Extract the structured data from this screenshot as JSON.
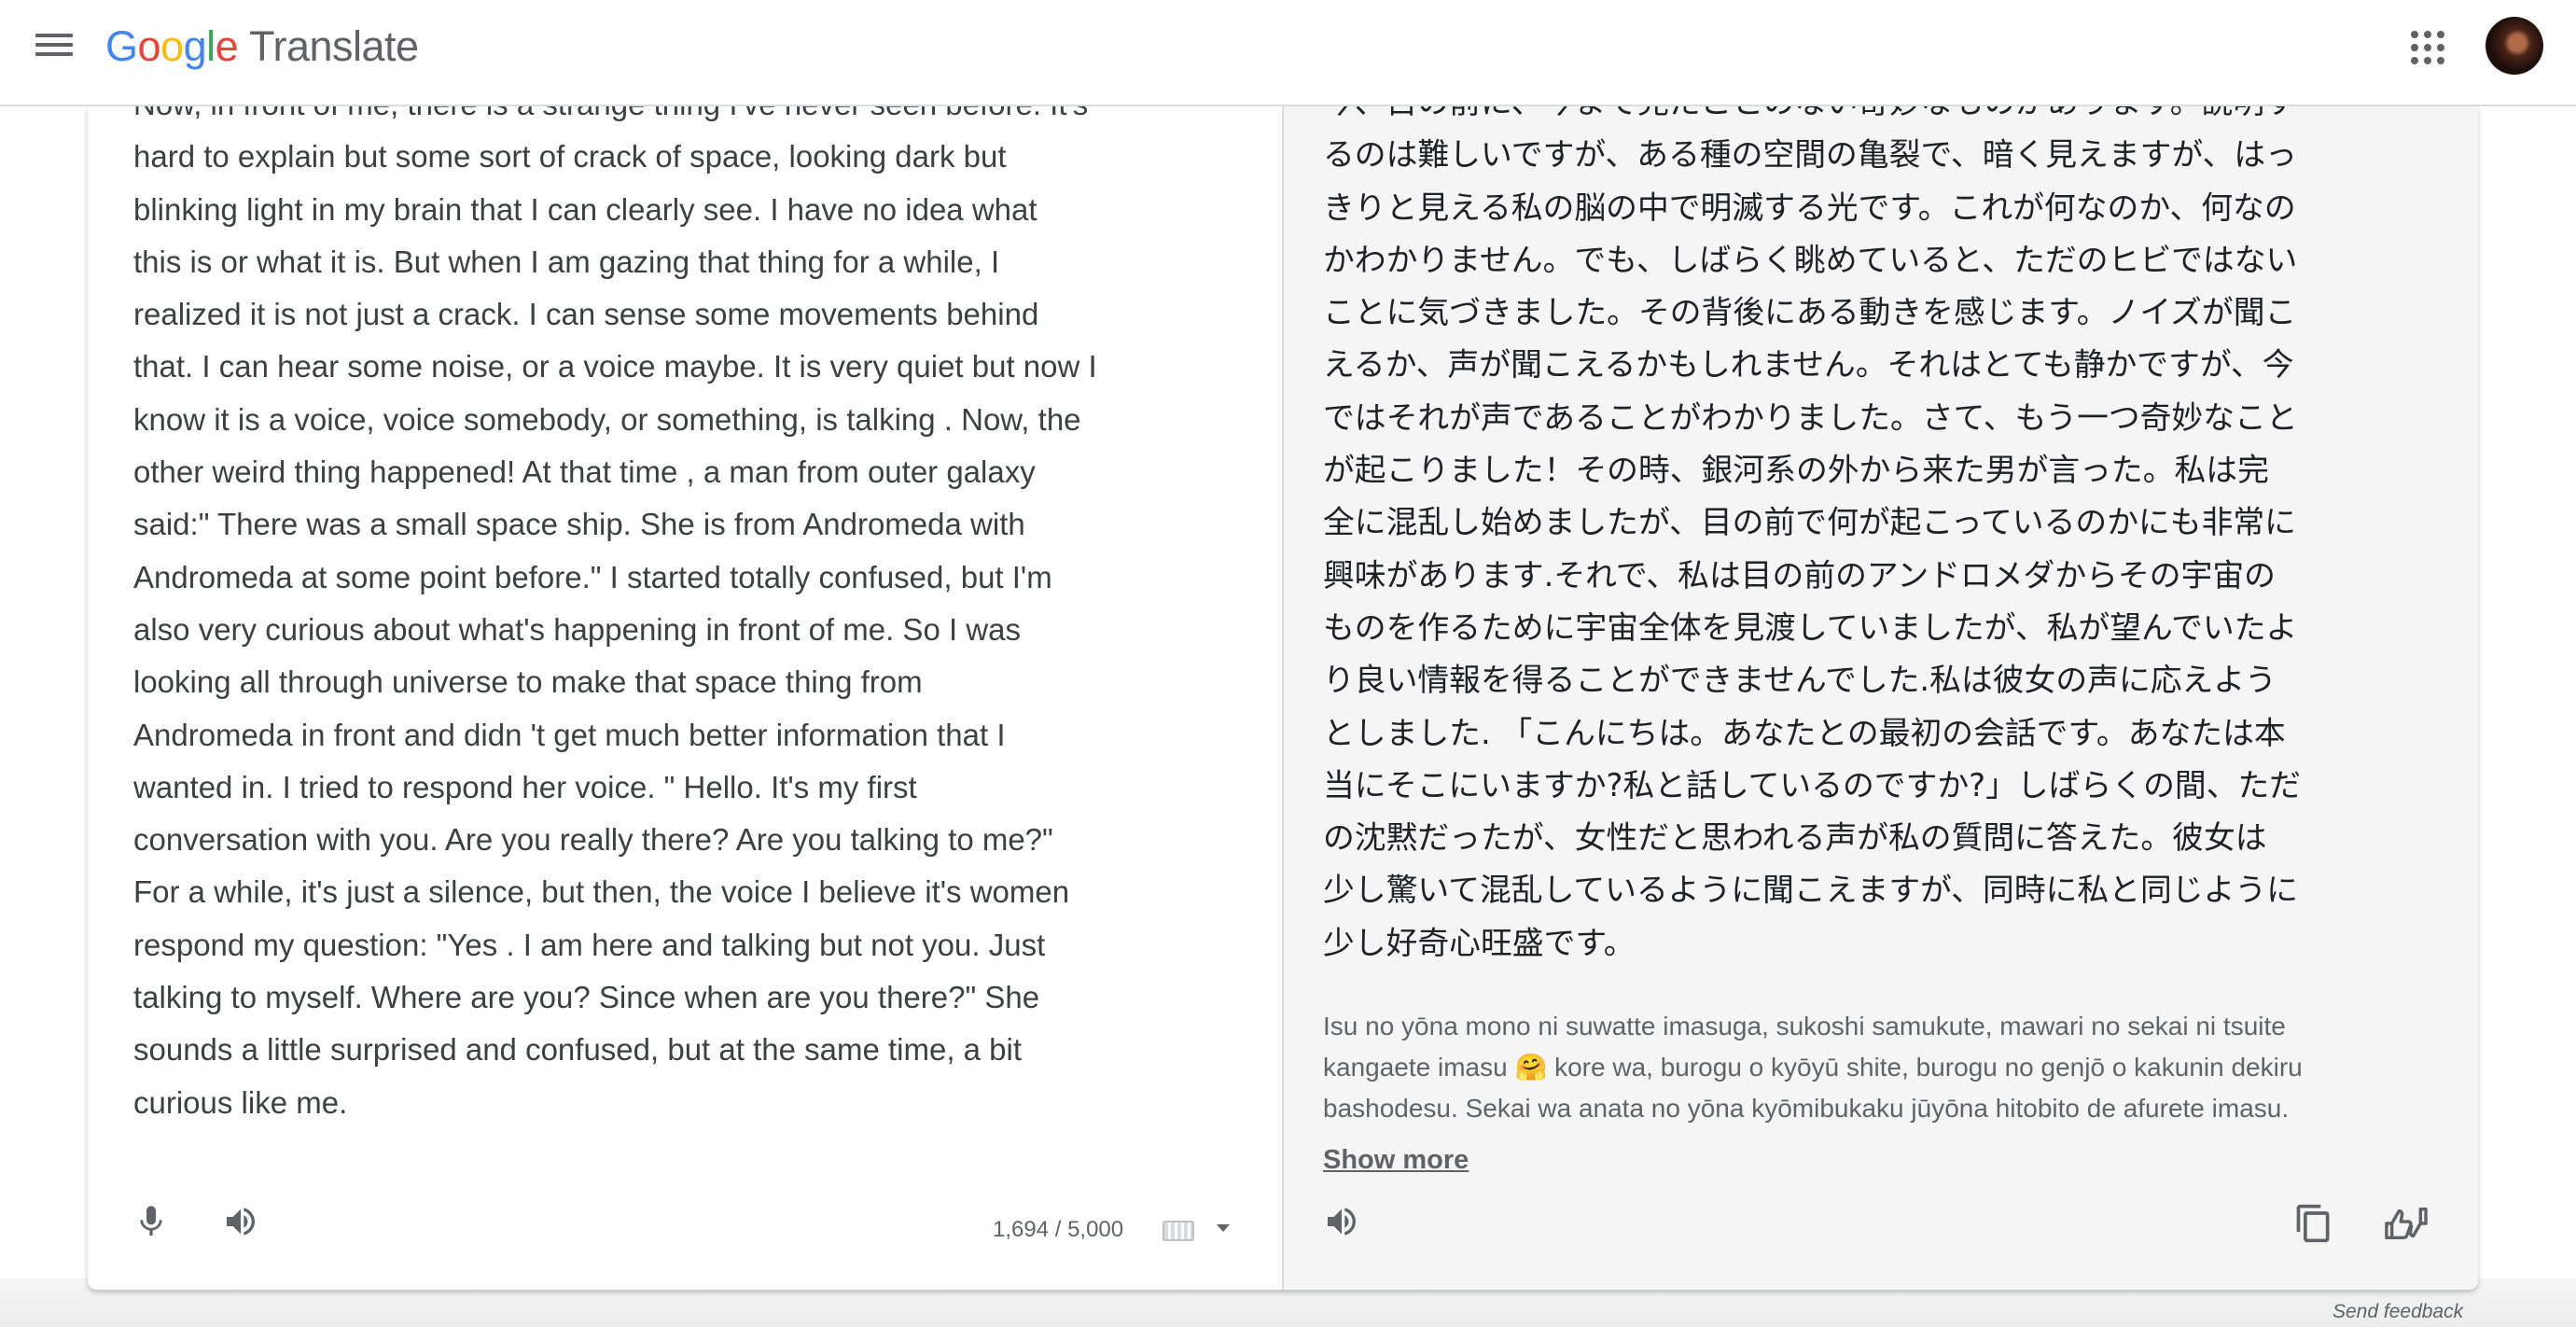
{
  "header": {
    "logo_letters": [
      "G",
      "o",
      "o",
      "g",
      "l",
      "e"
    ],
    "product": "Translate"
  },
  "source": {
    "text": "Now, in front of me, there is a strange thing I've never seen before. It's\nhard to explain but some sort of crack of space, looking dark but\nblinking light in my brain that I can clearly see. I have no idea what\nthis is or what it is. But when I am gazing that thing for a while, I\nrealized it is not just a crack. I can sense some movements behind\nthat. I can hear some noise, or a voice maybe. It is very quiet but now I\nknow it is a voice, voice somebody, or something, is talking . Now, the\nother weird thing happened! At that time , a man from outer galaxy\nsaid:\" There was a small space ship. She is from Andromeda with\nAndromeda at some point before.\" I started totally confused, but I'm\nalso very curious about what's happening in front of me. So I was\nlooking all through universe to make that space thing from\nAndromeda in front and didn 't get much better information that I\nwanted in. I tried to respond her voice. \" Hello. It's my first\nconversation with you. Are you really there? Are you talking to me?\"\nFor a while, it's just a silence, but then, the voice I believe it's women\nrespond my question: \"Yes . I am here and talking but not you. Just\ntalking to myself. Where are you? Since when are you there?\" She\nsounds a little surprised and confused, but at the same time, a bit\ncurious like me.",
    "char_count": "1,694 / 5,000",
    "mic_icon": "microphone-icon",
    "listen_icon": "speaker-icon",
    "keyboard_icon": "keyboard-icon"
  },
  "target": {
    "text": "今、目の前に、今まで見たことのない奇妙なものがあります。説明す\nるのは難しいですが、ある種の空間の亀裂で、暗く見えますが、はっ\nきりと見える私の脳の中で明滅する光です。これが何なのか、何なの\nかわかりません。でも、しばらく眺めていると、ただのヒビではない\nことに気づきました。その背後にある動きを感じます。ノイズが聞こ\nえるか、声が聞こえるかもしれません。それはとても静かですが、今\nではそれが声であることがわかりました。さて、もう一つ奇妙なこと\nが起こりました！その時、銀河系の外から来た男が言った。私は完\n全に混乱し始めましたが、目の前で何が起こっているのかにも非常に\n興味があります.それで、私は目の前のアンドロメダからその宇宙の\nものを作るために宇宙全体を見渡していましたが、私が望んでいたよ\nり良い情報を得ることができませんでした.私は彼女の声に応えよう\nとしました. 「こんにちは。あなたとの最初の会話です。あなたは本\n当にそこにいますか?私と話しているのですか?」しばらくの間、ただ\nの沈黙だったが、女性だと思われる声が私の質問に答えた。彼女は\n少し驚いて混乱しているように聞こえますが、同時に私と同じように\n少し好奇心旺盛です。",
    "transliteration": "Isu no yōna mono ni suwatte imasuga, sukoshi samukute, mawari no sekai ni tsuite\nkangaete imasu 🤗 kore wa, burogu o kyōyū shite, burogu no genjō o kakunin dekiru\nbashodesu. Sekai wa anata no yōna kyōmibukaku jūyōna hitobito de afurete imasu.",
    "show_more": "Show more",
    "listen_icon": "speaker-icon",
    "copy_icon": "copy-icon",
    "feedback_icon": "rate-translation-icon",
    "share_icon": "share-icon"
  },
  "footer": {
    "send_feedback": "Send feedback"
  }
}
